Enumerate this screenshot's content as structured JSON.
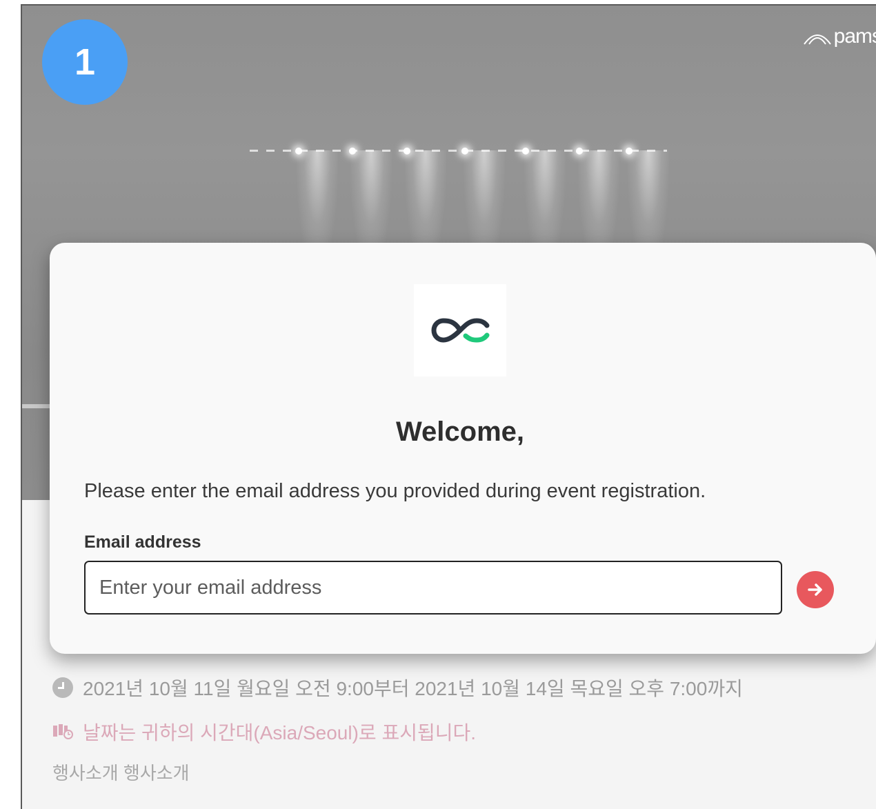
{
  "step_badge": "1",
  "brand": {
    "text": "pams"
  },
  "modal": {
    "logo": "infinity-logo-icon",
    "title": "Welcome,",
    "instructions": "Please enter the email address you provided during event registration.",
    "email_label": "Email address",
    "email_value": "",
    "email_placeholder": "Enter your email address",
    "submit_icon": "arrow-right-icon"
  },
  "event": {
    "date_range": "2021년 10월 11일 월요일 오전 9:00부터 2021년 10월 14일 목요일 오후 7:00까지",
    "timezone_notice": "날짜는 귀하의 시간대(Asia/Seoul)로 표시됩니다.",
    "description": "행사소개 행사소개"
  },
  "colors": {
    "badge": "#4a9ff5",
    "submit": "#e8585d",
    "logo_dark": "#2b3440",
    "logo_green": "#1fc97b",
    "timezone_text": "#dba8b8"
  }
}
